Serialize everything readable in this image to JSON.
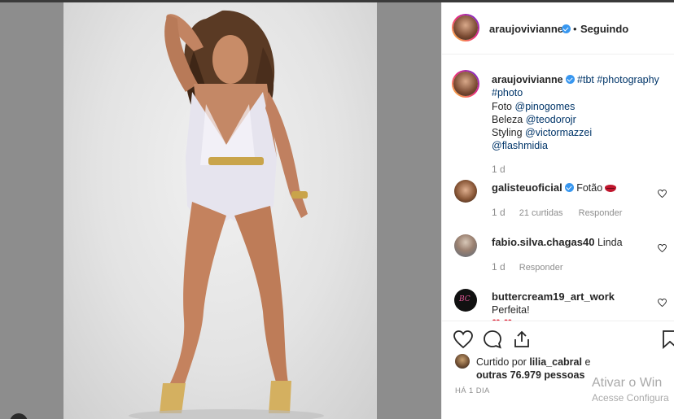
{
  "header": {
    "username": "araujovivianne",
    "separator": "•",
    "follow_status": "Seguindo"
  },
  "caption": {
    "username": "araujovivianne",
    "hashtags": "#tbt #photography #photo",
    "lines": [
      {
        "label": "Foto",
        "mention": "@pinogomes"
      },
      {
        "label": "Beleza",
        "mention": "@teodorojr"
      },
      {
        "label": "Styling",
        "mention": "@victormazzei"
      },
      {
        "label": "",
        "mention": "@flashmidia"
      }
    ],
    "time": "1 d"
  },
  "comments": [
    {
      "username": "galisteuoficial",
      "text": "Fotão",
      "emoji": "lips",
      "time": "1 d",
      "likes": "21 curtidas",
      "reply": "Responder",
      "verified": true
    },
    {
      "username": "fabio.silva.chagas40",
      "text": "Linda",
      "time": "1 d",
      "reply": "Responder",
      "verified": false
    },
    {
      "username": "buttercream19_art_work",
      "text": "Perfeita!",
      "emoji": "❤ ❤",
      "verified": false
    }
  ],
  "actions": {
    "liked_prefix": "Curtido por",
    "liked_user": "lilia_cabral",
    "liked_and": "e",
    "liked_others": "outras 76.979 pessoas",
    "timestamp": "HÁ 1 DIA"
  },
  "watermark": {
    "line1": "Ativar o Win",
    "line2": "Acesse Configura"
  },
  "colors": {
    "link": "#003569",
    "verified": "#3897f0",
    "muted": "#8e8e8e",
    "text": "#262626",
    "heart": "#e0182e"
  }
}
